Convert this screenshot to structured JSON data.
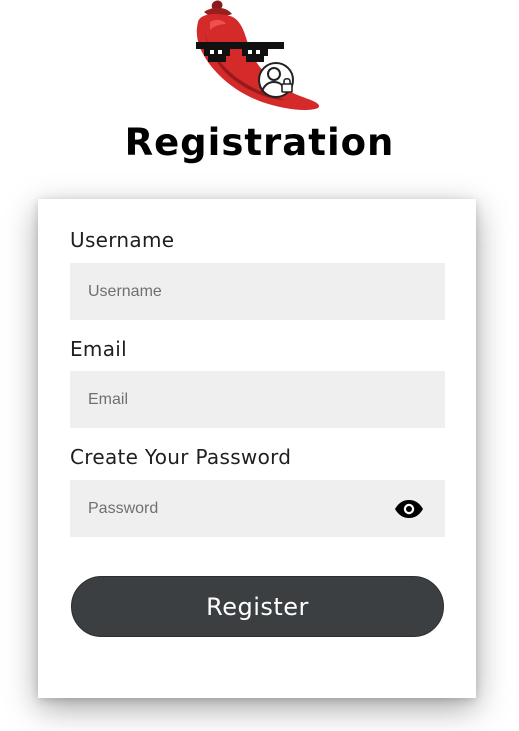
{
  "header": {
    "logo_icon": "chili-pepper-sunglasses-user-lock-logo",
    "title": "Registration"
  },
  "form": {
    "username": {
      "label": "Username",
      "placeholder": "Username",
      "value": ""
    },
    "email": {
      "label": "Email",
      "placeholder": "Email",
      "value": ""
    },
    "password": {
      "label": "Create Your Password",
      "placeholder": "Password",
      "value": "",
      "toggle_icon": "eye-icon"
    },
    "submit_label": "Register"
  },
  "colors": {
    "button_bg": "#3b3f42",
    "input_bg": "#efefef",
    "logo_red": "#d42a2a"
  }
}
